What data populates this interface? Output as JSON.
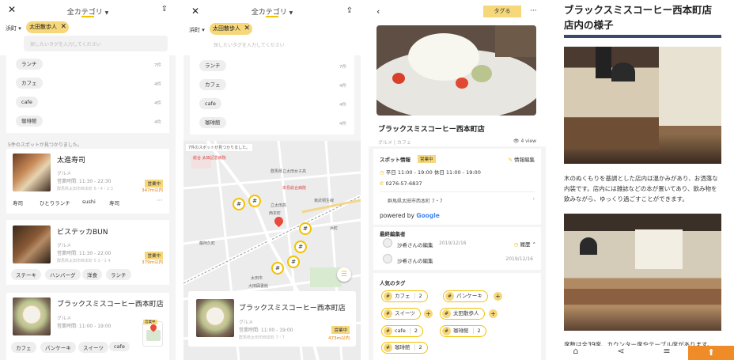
{
  "list_screen": {
    "category_title": "全カテゴリ",
    "location": "浜町",
    "selected_tag": "太田散歩人",
    "input_placeholder": "探したいタグを入力してください",
    "categories": [
      {
        "label": "ランチ",
        "count": "7件"
      },
      {
        "label": "カフェ",
        "count": "4件"
      },
      {
        "label": "cafe",
        "count": "4件"
      },
      {
        "label": "珈琲館",
        "count": "4件"
      }
    ],
    "found_text": "5件のスポットが見つかりました。",
    "cards": [
      {
        "title": "太進寿司",
        "genre": "グルメ",
        "hours": "営業時間: 11:30 - 22:30",
        "address": "群馬県太田市西本町 6・4・2 3",
        "status": "営業中",
        "distance": "347m以内",
        "tags": [
          "寿司",
          "ひとりランチ",
          "sushi",
          "寿司"
        ]
      },
      {
        "title": "ビステッカBUN",
        "genre": "グルメ",
        "hours": "営業時間: 11:30 - 22:00",
        "address": "群馬県太田市西本町 5 3・1 4",
        "status": "営業中",
        "distance": "379m以内",
        "tags": [
          "ステーキ",
          "ハンバーグ",
          "洋食",
          "ランチ"
        ]
      },
      {
        "title": "ブラックスミスコーヒー西本町店",
        "genre": "グルメ",
        "hours": "営業時間: 11:00 - 19:00",
        "tags": [
          "カフェ",
          "パンケーキ",
          "スイーツ",
          "cafe"
        ]
      }
    ]
  },
  "map_screen": {
    "category_title": "全カテゴリ",
    "location": "浜町",
    "selected_tag": "太田散歩人",
    "input_placeholder": "探したいタグを入力してください",
    "categories": [
      {
        "label": "ランチ",
        "count": "7件"
      },
      {
        "label": "カフェ",
        "count": "4件"
      },
      {
        "label": "cafe",
        "count": "4件"
      },
      {
        "label": "珈琲館",
        "count": "4件"
      }
    ],
    "found_text": "7件のスポットが見つかりました。",
    "map_labels": [
      "群馬県立太田女子高",
      "立太田高",
      "西本町",
      "浜町",
      "本島総合病院",
      "藤阿久町",
      "東武桐生線",
      "太田市",
      "総合 太田記念病院",
      "大田図書館"
    ],
    "card": {
      "title": "ブラックスミスコーヒー西本町店",
      "genre": "グルメ",
      "hours": "営業時間: 11:00 - 19:00",
      "address": "群馬県太田市西本町 7・7",
      "status": "営業中",
      "distance": "473m以内"
    }
  },
  "detail_screen": {
    "tag_button": "タグる",
    "name": "ブラックスミスコーヒー西本町店",
    "genre": "グルメ | カフェ",
    "views": "4 view",
    "spot_info_label": "スポット情報",
    "status": "営業中",
    "edit_info": "情報編集",
    "hours": "平日 11:00 - 19:00 休日 11:00 - 19:00",
    "phone": "0276-57-6837",
    "address": "群馬県太田市西本町 7・7",
    "powered_by": "powered by",
    "google": "Google",
    "last_editor_label": "最終編集者",
    "editors": [
      {
        "name": "沙希さんの編集",
        "date": "2019/12/16"
      },
      {
        "name": "沙希さんの編集",
        "date": "2019/12/16"
      }
    ],
    "history": "履歴",
    "popular_tags_label": "人気のタグ",
    "tags": [
      {
        "label": "カフェ",
        "count": "2"
      },
      {
        "label": "パンケーキ",
        "count": ""
      },
      {
        "label": "スイーツ",
        "count": ""
      },
      {
        "label": "太田散歩人",
        "count": ""
      },
      {
        "label": "cafe",
        "count": "2"
      },
      {
        "label": "珈琲館",
        "count": "2"
      },
      {
        "label": "珈琲館",
        "count": "2"
      }
    ]
  },
  "article": {
    "title": "ブラックスミスコーヒー西本町店 店内の様子",
    "body": "木のぬくもりを基調とした店内は温かみがあり、お洒落な内装です。店内には雑誌などの本が置いてあり、飲み物を飲みながら、ゆっくり過ごすことができます。",
    "footer_text": "席数は全39席、カウンター席やテーブル席があります。"
  },
  "colors": {
    "accent": "#f2c200",
    "accent_light": "#f6d77a",
    "orange": "#f08c28",
    "dark_bar": "#3a4a6a"
  }
}
